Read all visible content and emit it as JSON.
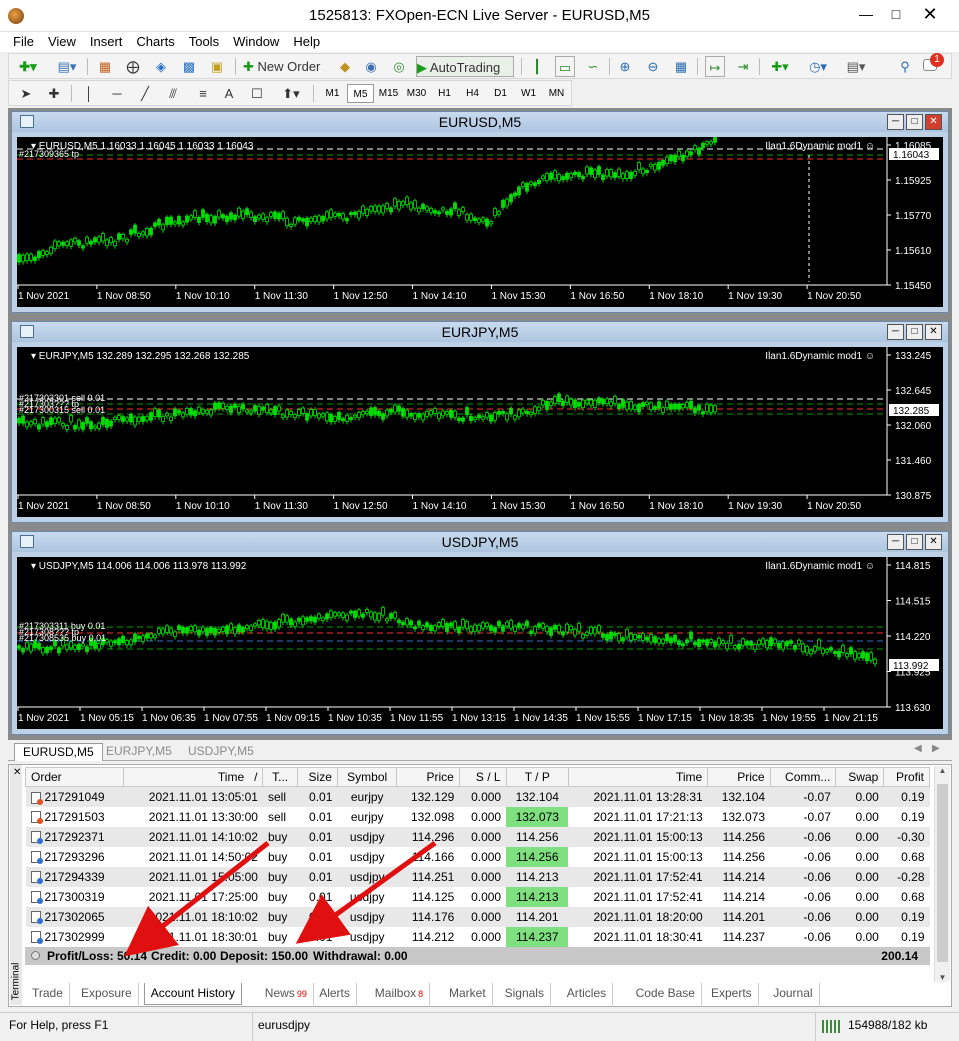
{
  "window": {
    "title": "1525813: FXOpen-ECN Live Server - EURUSD,M5"
  },
  "menu": [
    "File",
    "View",
    "Insert",
    "Charts",
    "Tools",
    "Window",
    "Help"
  ],
  "toolbar": {
    "new_order": "New Order",
    "autotrading": "AutoTrading",
    "alert_count": "1"
  },
  "timeframes": [
    "M1",
    "M5",
    "M15",
    "M30",
    "H1",
    "H4",
    "D1",
    "W1",
    "MN"
  ],
  "active_timeframe": "M5",
  "charts": [
    {
      "title": "EURUSD,M5",
      "header": "EURUSD,M5  1.16033 1.16045 1.16033 1.16043",
      "ea": "Ilan1.6Dynamic mod1",
      "order_labels": [
        "#217309365 tp"
      ],
      "price_ticks": [
        "1.16085",
        "1.15925",
        "1.15770",
        "1.15610",
        "1.15450"
      ],
      "current_price": "1.16043",
      "time_ticks": [
        "1 Nov 2021",
        "1 Nov 08:50",
        "1 Nov 10:10",
        "1 Nov 11:30",
        "1 Nov 12:50",
        "1 Nov 14:10",
        "1 Nov 15:30",
        "1 Nov 16:50",
        "1 Nov 18:10",
        "1 Nov 19:30",
        "1 Nov 20:50"
      ]
    },
    {
      "title": "EURJPY,M5",
      "header": "EURJPY,M5  132.289 132.295 132.268 132.285",
      "ea": "Ilan1.6Dynamic mod1",
      "order_labels": [
        "#217303301 sell 0.01",
        "#217303??? tp",
        "#217300315 sell 0.01"
      ],
      "price_ticks": [
        "133.245",
        "132.645",
        "132.060",
        "131.460",
        "130.875"
      ],
      "current_price": "132.285",
      "time_ticks": [
        "1 Nov 2021",
        "1 Nov 08:50",
        "1 Nov 10:10",
        "1 Nov 11:30",
        "1 Nov 12:50",
        "1 Nov 14:10",
        "1 Nov 15:30",
        "1 Nov 16:50",
        "1 Nov 18:10",
        "1 Nov 19:30",
        "1 Nov 20:50"
      ]
    },
    {
      "title": "USDJPY,M5",
      "header": "USDJPY,M5  114.006 114.006 113.978 113.992",
      "ea": "Ilan1.6Dynamic mod1",
      "order_labels": [
        "#217303311 buy 0.01",
        "#217308??? tp",
        "#217308535 buy 0.01"
      ],
      "price_ticks": [
        "114.815",
        "114.515",
        "114.220",
        "113.925",
        "113.630"
      ],
      "current_price": "113.992",
      "time_ticks": [
        "1 Nov 2021",
        "1 Nov 05:15",
        "1 Nov 06:35",
        "1 Nov 07:55",
        "1 Nov 09:15",
        "1 Nov 10:35",
        "1 Nov 11:55",
        "1 Nov 13:15",
        "1 Nov 14:35",
        "1 Nov 15:55",
        "1 Nov 17:15",
        "1 Nov 18:35",
        "1 Nov 19:55",
        "1 Nov 21:15"
      ]
    }
  ],
  "chart_tabs": [
    "EURUSD,M5",
    "EURJPY,M5",
    "USDJPY,M5"
  ],
  "history": {
    "columns": [
      "Order",
      "Time",
      "T...",
      "Size",
      "Symbol",
      "Price",
      "S / L",
      "T / P",
      "Time",
      "Price",
      "Comm...",
      "Swap",
      "Profit"
    ],
    "sort_marker": "/",
    "rows": [
      [
        "217291049",
        "2021.11.01 13:05:01",
        "sell",
        "0.01",
        "eurjpy",
        "132.129",
        "0.000",
        "132.104",
        "2021.11.01 13:28:31",
        "132.104",
        "-0.07",
        "0.00",
        "0.19"
      ],
      [
        "217291503",
        "2021.11.01 13:30:00",
        "sell",
        "0.01",
        "eurjpy",
        "132.098",
        "0.000",
        "132.073",
        "2021.11.01 17:21:13",
        "132.073",
        "-0.07",
        "0.00",
        "0.19"
      ],
      [
        "217292371",
        "2021.11.01 14:10:02",
        "buy",
        "0.01",
        "usdjpy",
        "114.296",
        "0.000",
        "114.256",
        "2021.11.01 15:00:13",
        "114.256",
        "-0.06",
        "0.00",
        "-0.30"
      ],
      [
        "217293296",
        "2021.11.01 14:50:02",
        "buy",
        "0.01",
        "usdjpy",
        "114.166",
        "0.000",
        "114.256",
        "2021.11.01 15:00:13",
        "114.256",
        "-0.06",
        "0.00",
        "0.68"
      ],
      [
        "217294339",
        "2021.11.01 15:05:00",
        "buy",
        "0.01",
        "usdjpy",
        "114.251",
        "0.000",
        "114.213",
        "2021.11.01 17:52:41",
        "114.214",
        "-0.06",
        "0.00",
        "-0.28"
      ],
      [
        "217300319",
        "2021.11.01 17:25:00",
        "buy",
        "0.01",
        "usdjpy",
        "114.125",
        "0.000",
        "114.213",
        "2021.11.01 17:52:41",
        "114.214",
        "-0.06",
        "0.00",
        "0.68"
      ],
      [
        "217302065",
        "2021.11.01 18:10:02",
        "buy",
        "0.01",
        "usdjpy",
        "114.176",
        "0.000",
        "114.201",
        "2021.11.01 18:20:00",
        "114.201",
        "-0.06",
        "0.00",
        "0.19"
      ],
      [
        "217302999",
        "2021.11.01 18:30:01",
        "buy",
        "0.01",
        "usdjpy",
        "114.212",
        "0.000",
        "114.237",
        "2021.11.01 18:30:41",
        "114.237",
        "-0.06",
        "0.00",
        "0.19"
      ]
    ],
    "summary": {
      "profit_loss": "Profit/Loss: 50.14",
      "credit": "Credit: 0.00",
      "deposit": "Deposit: 150.00",
      "withdrawal": "Withdrawal: 0.00",
      "total": "200.14"
    }
  },
  "terminal_label": "Terminal",
  "bottom_tabs": [
    {
      "label": "Trade"
    },
    {
      "label": "Exposure"
    },
    {
      "label": "Account History"
    },
    {
      "label": "News",
      "badge": "99"
    },
    {
      "label": "Alerts"
    },
    {
      "label": "Mailbox",
      "badge": "8"
    },
    {
      "label": "Market"
    },
    {
      "label": "Signals"
    },
    {
      "label": "Articles"
    },
    {
      "label": "Code Base"
    },
    {
      "label": "Experts"
    },
    {
      "label": "Journal"
    }
  ],
  "active_bottom_tab": "Account History",
  "status": {
    "help": "For Help, press F1",
    "profile": "eurusdjpy",
    "traffic": "154988/182 kb"
  },
  "colors": {
    "candle": "#00e000",
    "grid": "#ffffff",
    "tp_line": "#00a000",
    "sl_line": "#ff3030",
    "tp_cell": "#7ee07e",
    "arrow": "#e01010"
  }
}
